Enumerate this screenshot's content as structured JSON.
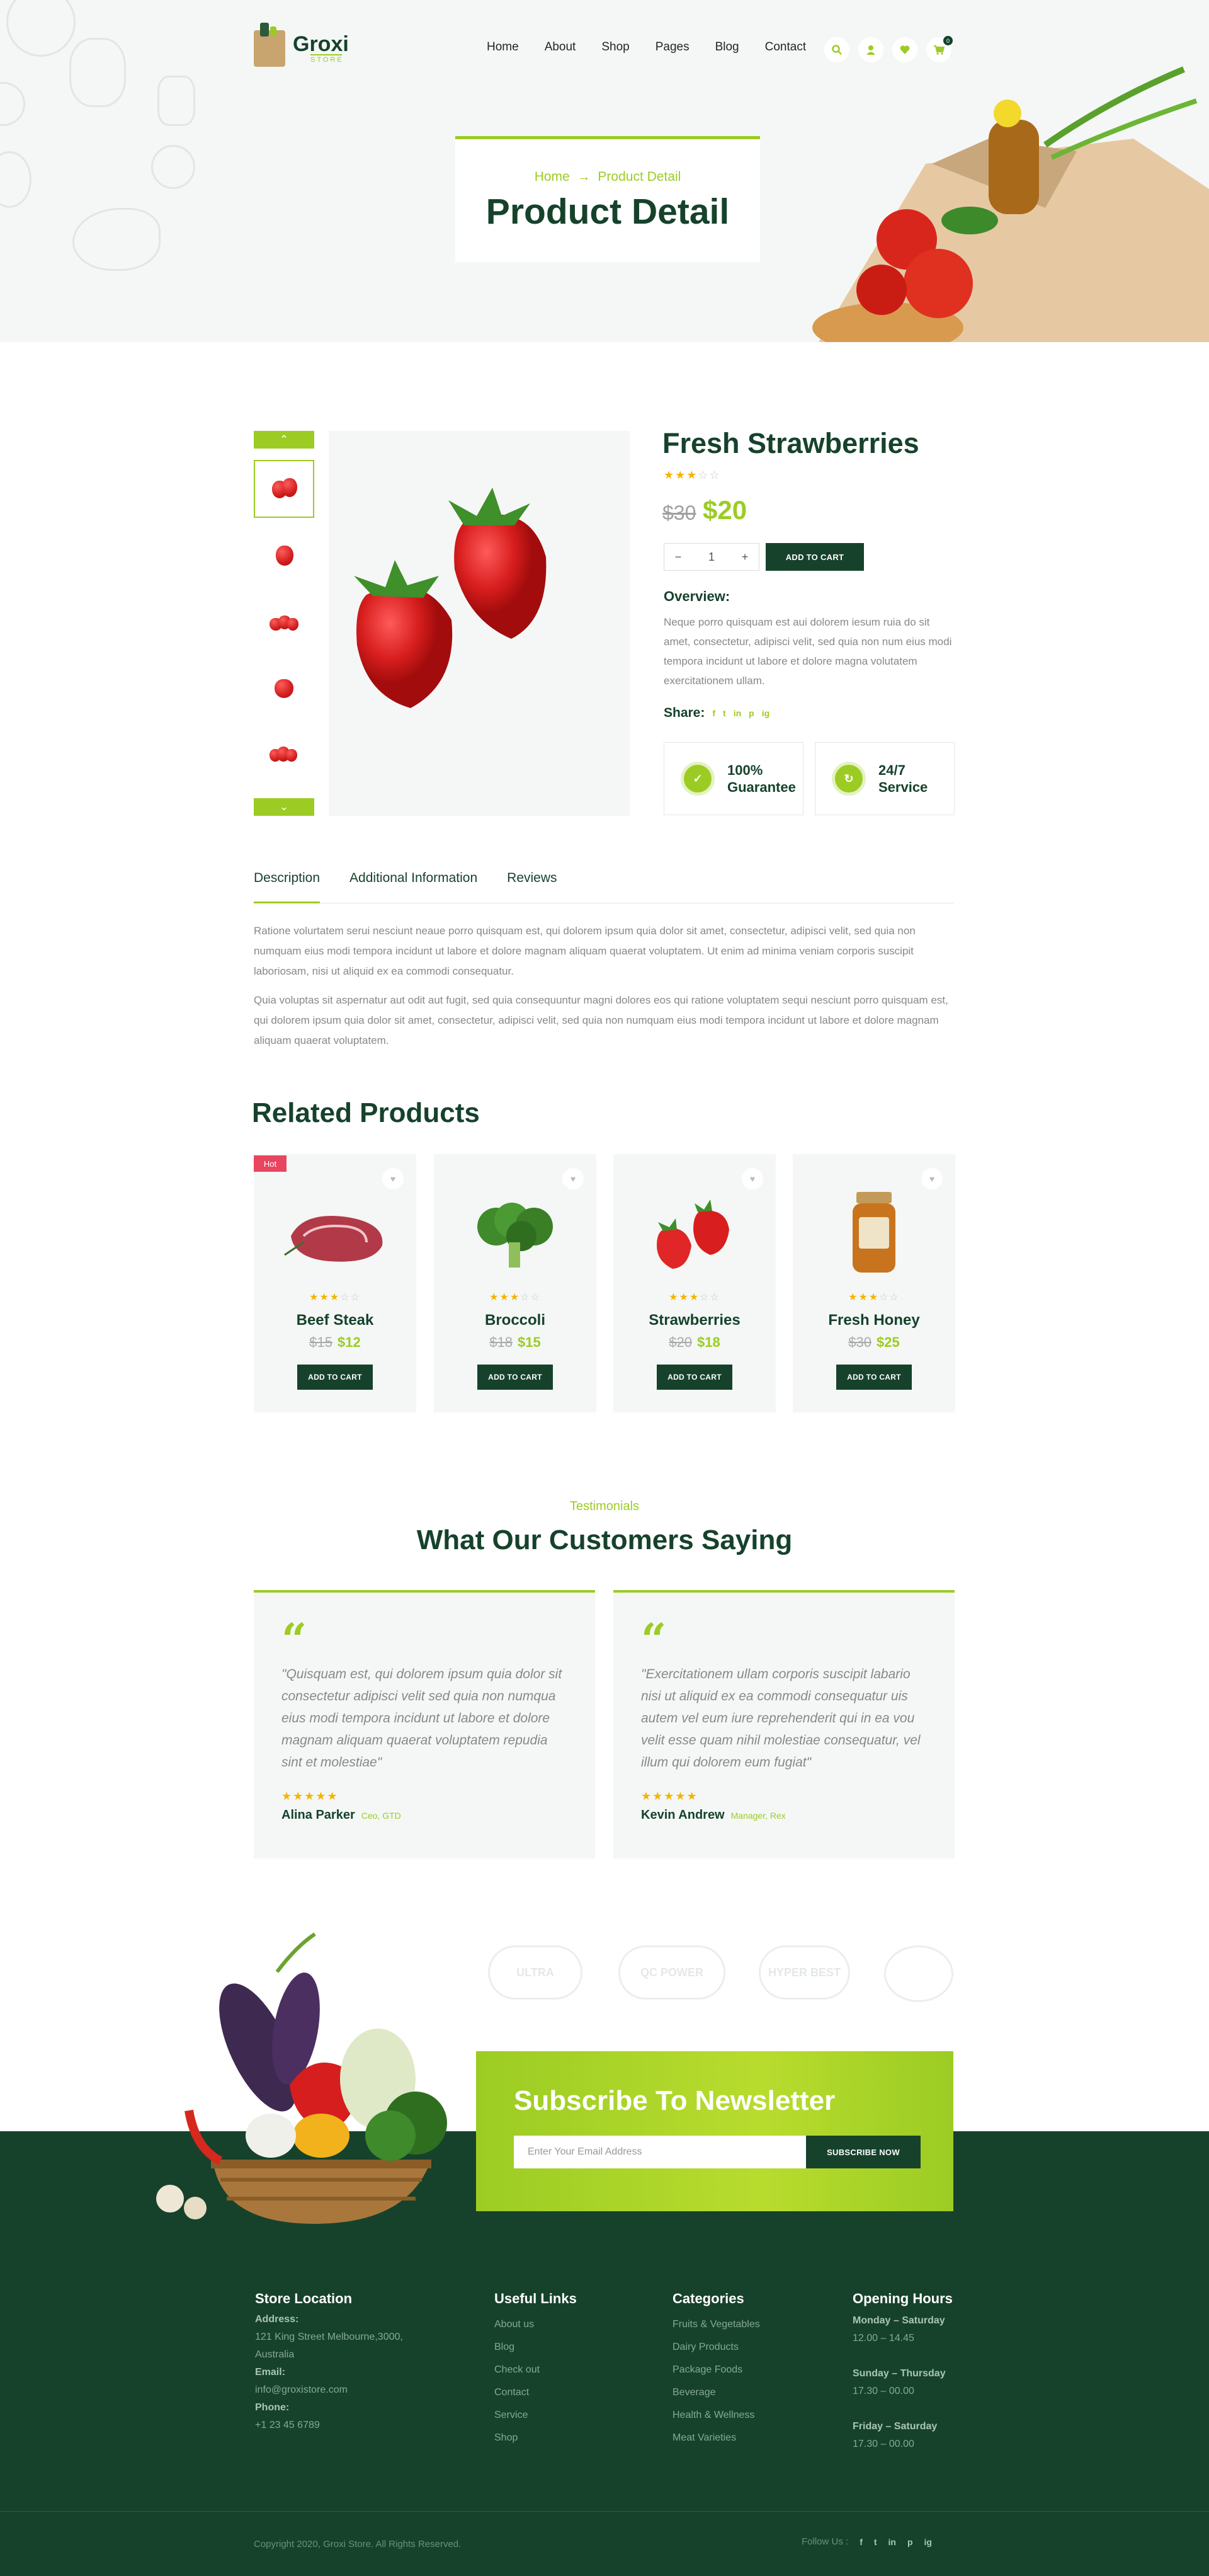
{
  "brand": {
    "name": "Groxi",
    "tagline": "STORE"
  },
  "nav": [
    "Home",
    "About",
    "Shop",
    "Pages",
    "Blog",
    "Contact"
  ],
  "header_icons": [
    "search-icon",
    "user-icon",
    "heart-icon",
    "cart-icon"
  ],
  "cart_count": "0",
  "page_header": {
    "breadcrumb_home": "Home",
    "breadcrumb_sep": "→",
    "breadcrumb_current": "Product Detail",
    "title": "Product Detail"
  },
  "product": {
    "name": "Fresh Strawberries",
    "rating": 3,
    "old_price": "$30",
    "price": "$20",
    "qty": "1",
    "qty_minus": "−",
    "qty_plus": "+",
    "add_to_cart": "ADD TO CART",
    "overview_title": "Overview:",
    "overview": "Neque porro quisquam est aui dolorem iesum ruia do sit amet, consectetur, adipisci velit, sed quia non num eius modi tempora incidunt ut labore et dolore magna volutatem exercitationem ullam.",
    "share_label": "Share:",
    "share_icons": [
      "f",
      "t",
      "in",
      "p",
      "ig"
    ],
    "features": [
      {
        "icon": "guarantee-icon",
        "line1": "100%",
        "line2": "Guarantee"
      },
      {
        "icon": "service-icon",
        "line1": "24/7",
        "line2": "Service"
      }
    ]
  },
  "tabs": [
    "Description",
    "Additional Information",
    "Reviews"
  ],
  "description": [
    "Ratione volurtatem serui nesciunt neaue porro quisquam est, qui dolorem ipsum quia dolor sit amet, consectetur, adipisci velit, sed quia non numquam eius modi tempora incidunt ut labore et dolore magnam aliquam quaerat voluptatem. Ut enim ad minima veniam corporis suscipit laboriosam, nisi ut aliquid ex ea commodi consequatur.",
    "Quia voluptas sit aspernatur aut odit aut fugit, sed quia consequuntur magni dolores eos qui ratione voluptatem sequi nesciunt porro quisquam est, qui dolorem ipsum quia dolor sit amet, consectetur, adipisci velit, sed quia non numquam eius modi tempora incidunt ut labore et dolore magnam aliquam quaerat voluptatem."
  ],
  "related": {
    "title": "Related Products",
    "hot_label": "Hot",
    "add_label": "ADD TO CART",
    "items": [
      {
        "name": "Beef Steak",
        "old": "$15",
        "price": "$12",
        "rating": 3
      },
      {
        "name": "Broccoli",
        "old": "$18",
        "price": "$15",
        "rating": 3
      },
      {
        "name": "Strawberries",
        "old": "$20",
        "price": "$18",
        "rating": 3
      },
      {
        "name": "Fresh Honey",
        "old": "$30",
        "price": "$25",
        "rating": 3
      }
    ]
  },
  "testimonials": {
    "subtitle": "Testimonials",
    "title": "What Our Customers Saying",
    "quote_mark": "“",
    "stars": "★★★★★",
    "items": [
      {
        "text": "\"Quisquam est, qui dolorem ipsum quia dolor sit consectetur adipisci velit sed quia non numqua eius modi tempora incidunt ut labore et dolore magnam aliquam quaerat voluptatem repudia sint et molestiae\"",
        "name": "Alina Parker",
        "role": "Ceo, GTD"
      },
      {
        "text": "\"Exercitationem ullam corporis suscipit labario nisi ut aliquid ex ea commodi consequatur uis autem vel eum iure reprehenderit qui in ea vou velit esse quam nihil molestiae consequatur, vel illum qui dolorem eum fugiat\"",
        "name": "Kevin Andrew",
        "role": "Manager, Rex"
      }
    ]
  },
  "badges": [
    "ULTRA",
    "QC POWER",
    "HYPER BEST",
    ""
  ],
  "newsletter": {
    "title": "Subscribe To Newsletter",
    "placeholder": "Enter Your Email Address",
    "button": "SUBSCRIBE NOW"
  },
  "footer": {
    "store": {
      "title": "Store Location",
      "address_label": "Address:",
      "address": "121 King Street Melbourne,3000, Australia",
      "email_label": "Email:",
      "email": "info@groxistore.com",
      "phone_label": "Phone:",
      "phone": "+1 23 45 6789"
    },
    "links": {
      "title": "Useful Links",
      "items": [
        "About us",
        "Blog",
        "Check out",
        "Contact",
        "Service",
        "Shop"
      ]
    },
    "categories": {
      "title": "Categories",
      "items": [
        "Fruits & Vegetables",
        "Dairy Products",
        "Package Foods",
        "Beverage",
        "Health & Wellness",
        "Meat Varieties"
      ]
    },
    "hours": {
      "title": "Opening Hours",
      "items": [
        {
          "days": "Monday – Saturday",
          "time": "12.00 – 14.45"
        },
        {
          "days": "Sunday – Thursday",
          "time": "17.30 – 00.00"
        },
        {
          "days": "Friday – Saturday",
          "time": "17.30 – 00.00"
        }
      ]
    },
    "copyright": "Copyright 2020, Groxi Store. All Rights Reserved.",
    "follow": "Follow Us :",
    "follow_icons": [
      "f",
      "t",
      "in",
      "p",
      "ig"
    ]
  },
  "colors": {
    "accent": "#9ccc23",
    "dark": "#16422c",
    "bg_light": "#f4f7f6",
    "hot": "#e94560",
    "star": "#f5b400"
  }
}
